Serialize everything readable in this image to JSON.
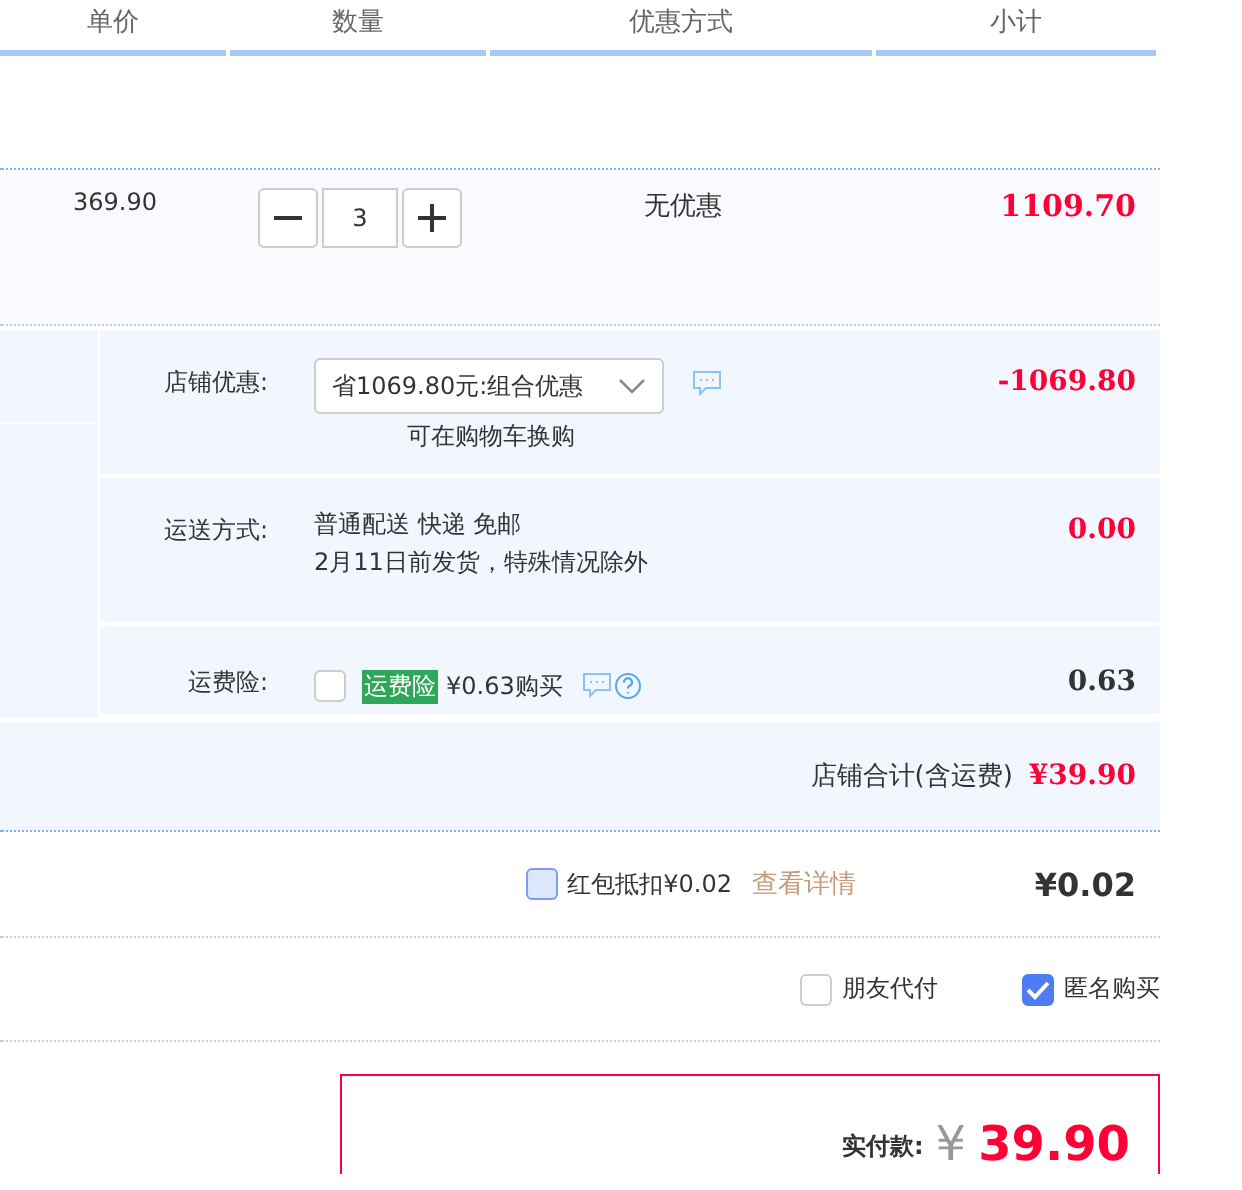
{
  "columns": [
    "单价",
    "数量",
    "优惠方式",
    "小计"
  ],
  "item": {
    "price": "369.90",
    "quantity": "3",
    "discount": "无优惠",
    "subtotal": "1109.70"
  },
  "shop_rows": [
    {
      "kind": "select",
      "label": "店铺优惠:",
      "value": "省1069.80元:组合优惠",
      "note": "可在购物车换购",
      "amount": "-1069.80",
      "color": "#ff0036"
    },
    {
      "kind": "text",
      "label": "运送方式:",
      "lines": [
        "普通配送 快递 免邮",
        "2月11日前发货，特殊情况除外"
      ],
      "amount": "0.00",
      "color": "#ff0036"
    },
    {
      "kind": "insurance",
      "label": "运费险:",
      "checked": false,
      "tag": "运费险",
      "text": "¥0.63购买",
      "amount": "0.63",
      "color": "#333333"
    }
  ],
  "shop_total": {
    "label": "店铺合计(含运费)",
    "amount": "¥39.90"
  },
  "red_packet": {
    "checked": false,
    "label": "红包抵扣¥0.02",
    "link": "查看详情",
    "amount": "¥0.02"
  },
  "options": [
    {
      "label": "朋友代付",
      "checked": false
    },
    {
      "label": "匿名购买",
      "checked": true
    }
  ],
  "pay": {
    "label": "实付款:",
    "currency": "¥",
    "amount": "39.90"
  }
}
